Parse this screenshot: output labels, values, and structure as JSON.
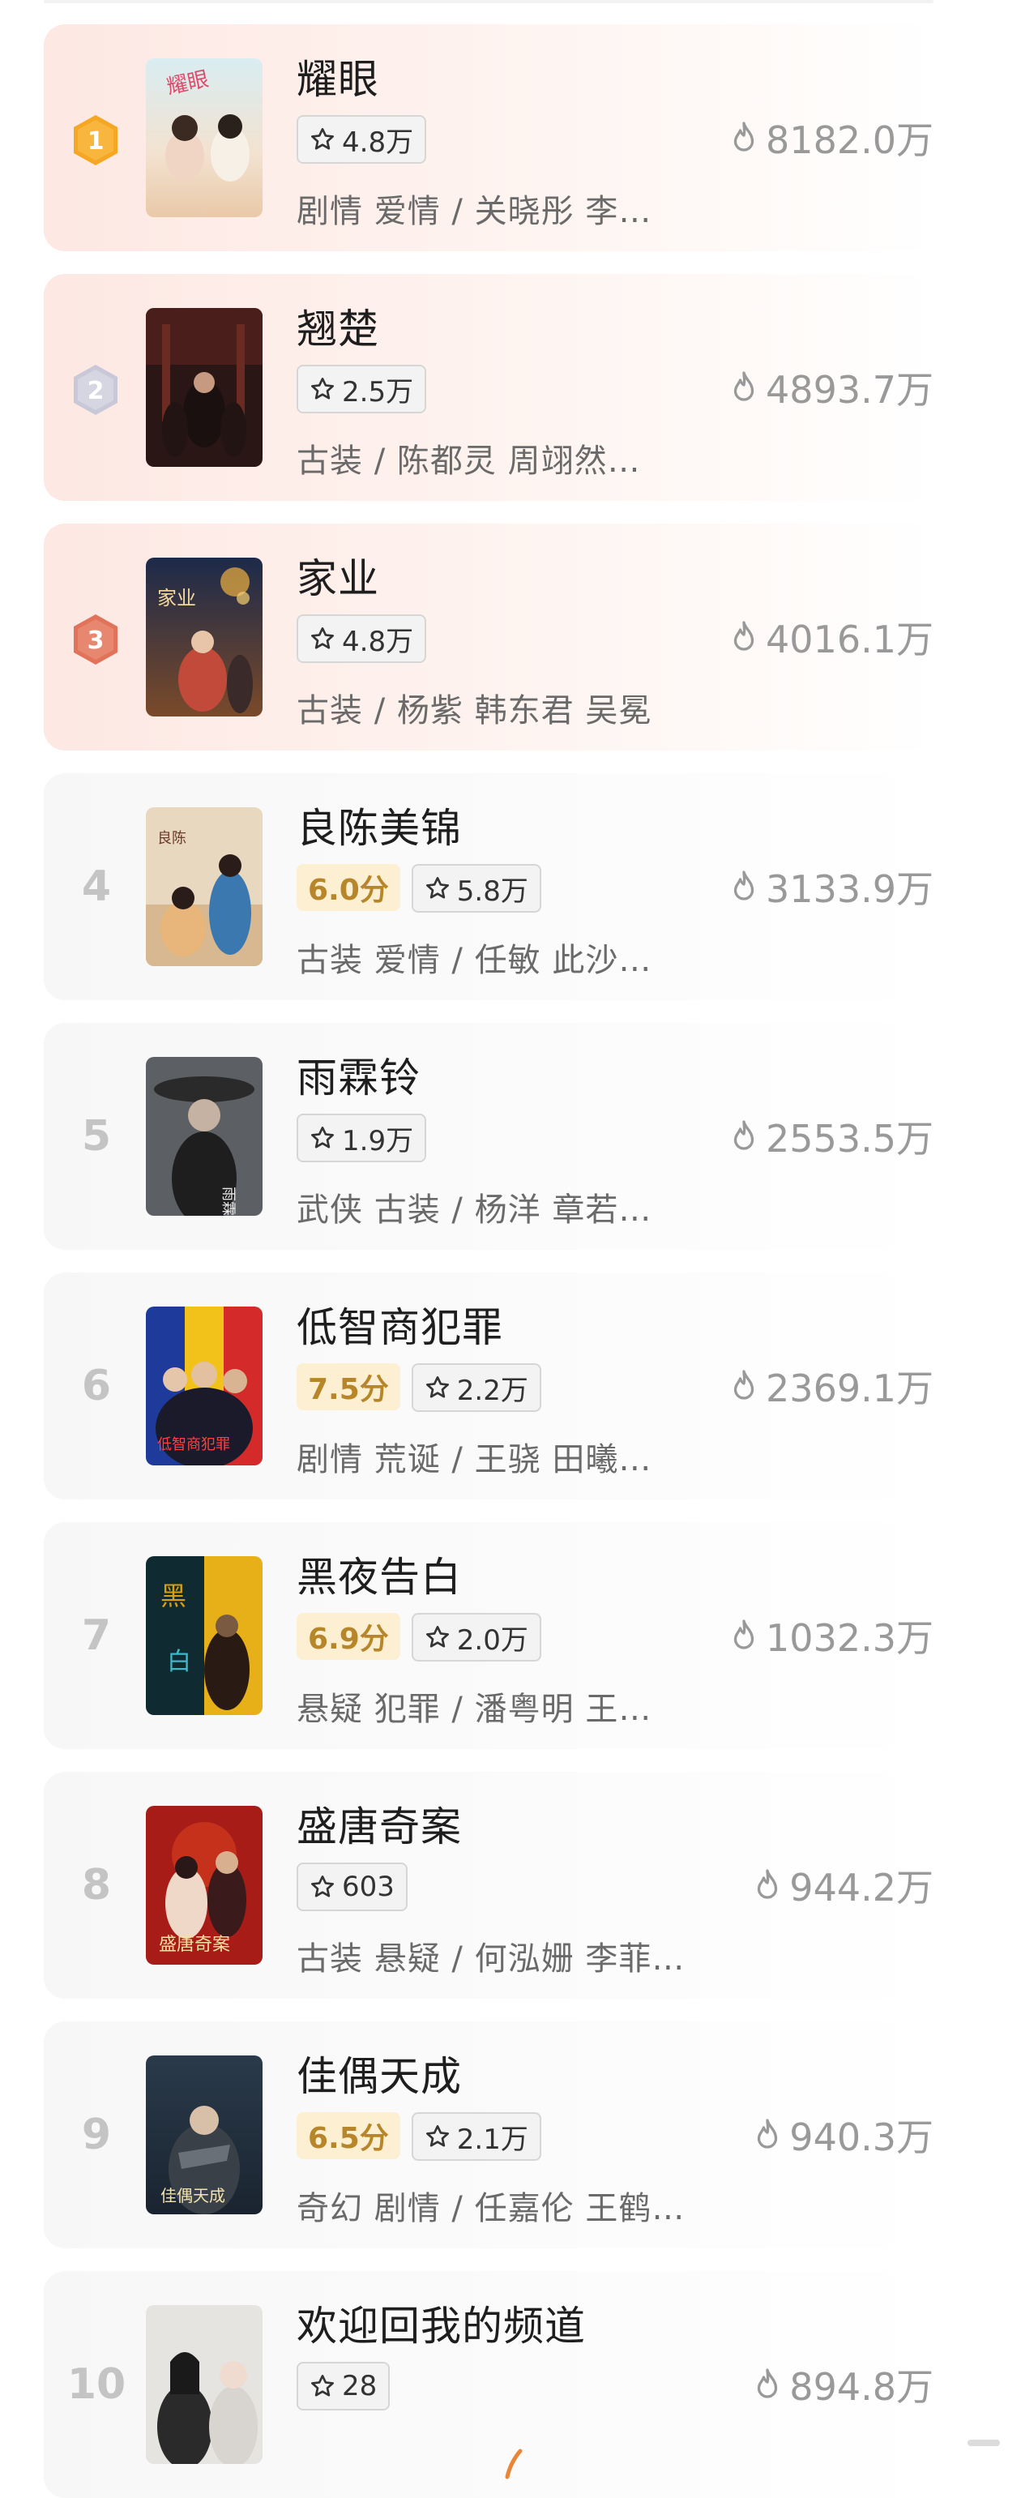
{
  "colors": {
    "gold": "#f5a623",
    "silver": "#c8c8d8",
    "bronze": "#e0735a",
    "score_bg": "#fdf0d2",
    "score_text": "#b8862a"
  },
  "icons": {
    "favorite": "star-outline-icon",
    "heat": "flame-outline-icon",
    "medal": "hexagon-medal-icon"
  },
  "items": [
    {
      "rank": "1",
      "title": "耀眼",
      "score": "",
      "favorites": "4.8万",
      "meta": "剧情 爱情 / 关晓彤 李…",
      "heat": "8182.0万"
    },
    {
      "rank": "2",
      "title": "翘楚",
      "score": "",
      "favorites": "2.5万",
      "meta": "古装 / 陈都灵 周翊然…",
      "heat": "4893.7万"
    },
    {
      "rank": "3",
      "title": "家业",
      "score": "",
      "favorites": "4.8万",
      "meta": "古装 / 杨紫 韩东君 吴冕",
      "heat": "4016.1万"
    },
    {
      "rank": "4",
      "title": "良陈美锦",
      "score": "6.0分",
      "favorites": "5.8万",
      "meta": "古装 爱情 / 任敏 此沙…",
      "heat": "3133.9万"
    },
    {
      "rank": "5",
      "title": "雨霖铃",
      "score": "",
      "favorites": "1.9万",
      "meta": "武侠 古装 / 杨洋 章若…",
      "heat": "2553.5万"
    },
    {
      "rank": "6",
      "title": "低智商犯罪",
      "score": "7.5分",
      "favorites": "2.2万",
      "meta": "剧情 荒诞 / 王骁 田曦…",
      "heat": "2369.1万"
    },
    {
      "rank": "7",
      "title": "黑夜告白",
      "score": "6.9分",
      "favorites": "2.0万",
      "meta": "悬疑 犯罪 / 潘粤明 王…",
      "heat": "1032.3万"
    },
    {
      "rank": "8",
      "title": "盛唐奇案",
      "score": "",
      "favorites": "603",
      "meta": "古装 悬疑 / 何泓姗 李菲…",
      "heat": "944.2万"
    },
    {
      "rank": "9",
      "title": "佳偶天成",
      "score": "6.5分",
      "favorites": "2.1万",
      "meta": "奇幻 剧情 / 任嘉伦 王鹤…",
      "heat": "940.3万"
    },
    {
      "rank": "10",
      "title": "欢迎回我的频道",
      "score": "",
      "favorites": "28",
      "meta": "",
      "heat": "894.8万"
    }
  ]
}
